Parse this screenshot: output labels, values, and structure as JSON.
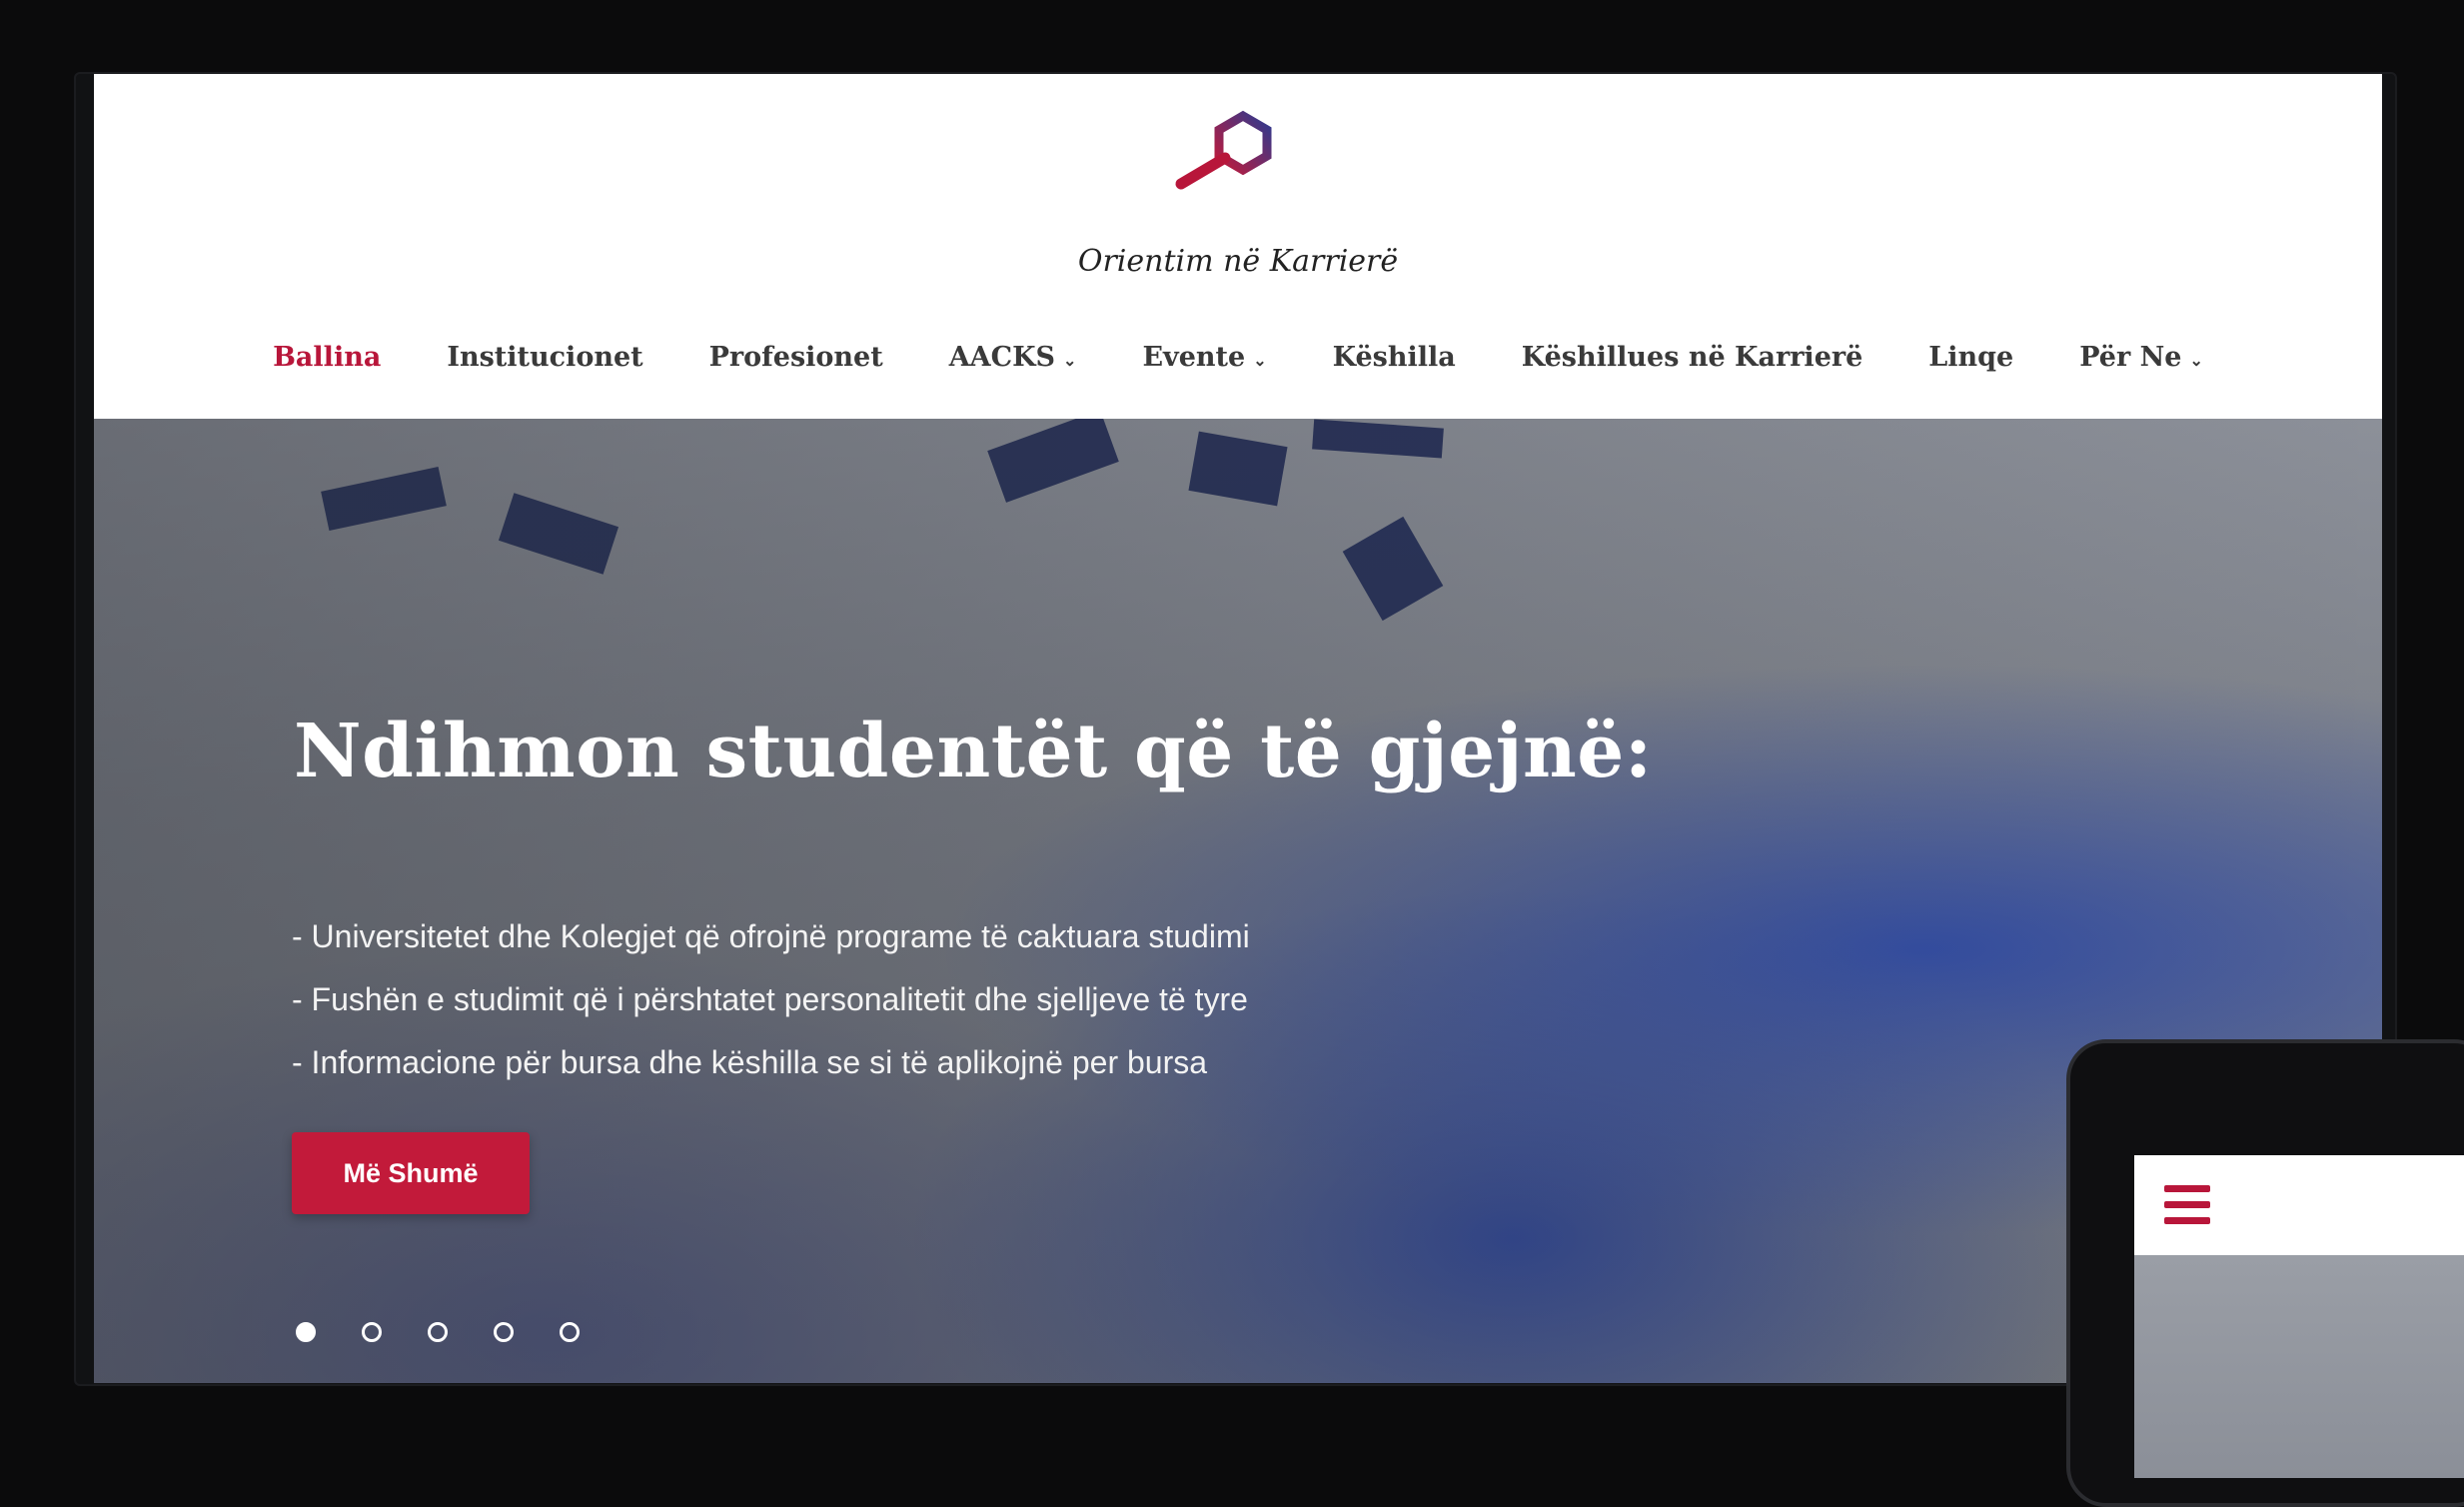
{
  "site": {
    "title": "Orientim në Karrierë",
    "brand_colors": {
      "accent": "#b8163a",
      "logo_blue": "#2f3a8f"
    }
  },
  "nav": {
    "items": [
      {
        "label": "Ballina",
        "active": true,
        "dropdown": false
      },
      {
        "label": "Institucionet",
        "active": false,
        "dropdown": false
      },
      {
        "label": "Profesionet",
        "active": false,
        "dropdown": false
      },
      {
        "label": "AACKS",
        "active": false,
        "dropdown": true
      },
      {
        "label": "Evente",
        "active": false,
        "dropdown": true
      },
      {
        "label": "Këshilla",
        "active": false,
        "dropdown": false
      },
      {
        "label": "Këshillues në Karrierë",
        "active": false,
        "dropdown": false
      },
      {
        "label": "Linqe",
        "active": false,
        "dropdown": false
      },
      {
        "label": "Për Ne",
        "active": false,
        "dropdown": true
      }
    ]
  },
  "hero": {
    "title": "Ndihmon studentët që të gjejnë:",
    "lines": [
      "- Universitetet dhe Kolegjet që ofrojnë programe të caktuara studimi",
      "- Fushën e studimit që i përshtatet personalitetit dhe sjelljeve të tyre",
      "- Informacione për bursa dhe këshilla se si të aplikojnë per bursa"
    ],
    "cta_label": "Më Shumë",
    "slides": {
      "count": 5,
      "active_index": 0
    }
  },
  "tablet": {
    "menu_icon": "hamburger-icon"
  }
}
